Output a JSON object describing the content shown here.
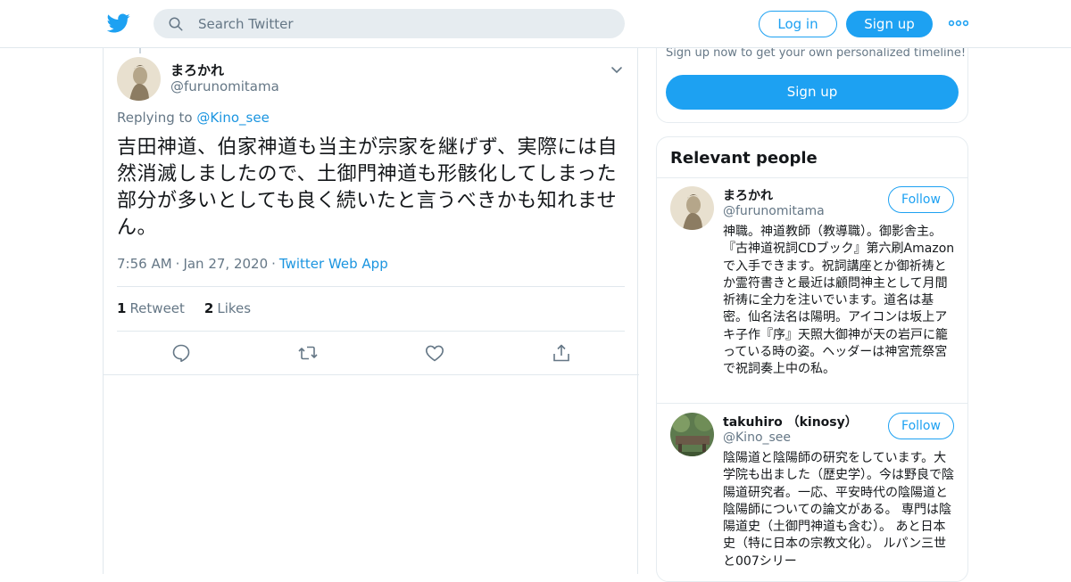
{
  "header": {
    "search_placeholder": "Search Twitter",
    "login_label": "Log in",
    "signup_label": "Sign up",
    "brand_color": "#1da1f2"
  },
  "tweet": {
    "author_name": "まろかれ",
    "author_handle": "@furunomitama",
    "replying_prefix": "Replying to ",
    "replying_handle": "@Kino_see",
    "text": "吉田神道、伯家神道も当主が宗家を継げず、実際には自然消滅しましたので、土御門神道も形骸化してしまった部分が多いとしても良く続いたと言うべきかも知れません。",
    "time": "7:56 AM",
    "date": "Jan 27, 2020",
    "source": "Twitter Web App",
    "retweet_count": "1",
    "retweet_label": "Retweet",
    "like_count": "2",
    "like_label": "Likes"
  },
  "sidebar": {
    "signup_prompt": "Sign up now to get your own personalized timeline!",
    "signup_button": "Sign up",
    "relevant_title": "Relevant people",
    "people": [
      {
        "name": "まろかれ",
        "handle": "@furunomitama",
        "follow_label": "Follow",
        "bio": "神職。神道教師（教導職）。御影舎主。 『古神道祝詞CDブック』第六刷Amazonで入手できます。祝詞講座とか御祈祷とか霊符書きと最近は顧問神主として月間祈祷に全力を注いでいます。道名は基密。仙名法名は陽明。アイコンは坂上アキ子作『序』天照大御神が天の岩戸に籠っている時の姿。ヘッダーは神宮荒祭宮で祝詞奏上中の私。"
      },
      {
        "name": "takuhiro （kinosy）",
        "handle": "@Kino_see",
        "follow_label": "Follow",
        "bio": "陰陽道と陰陽師の研究をしています。大学院も出ました（歴史学）。今は野良で陰陽道研究者。一応、平安時代の陰陽道と陰陽師についての論文がある。 専門は陰陽道史（土御門神道も含む）。 あと日本史（特に日本の宗教文化）。 ルパン三世と007シリー"
      }
    ]
  }
}
